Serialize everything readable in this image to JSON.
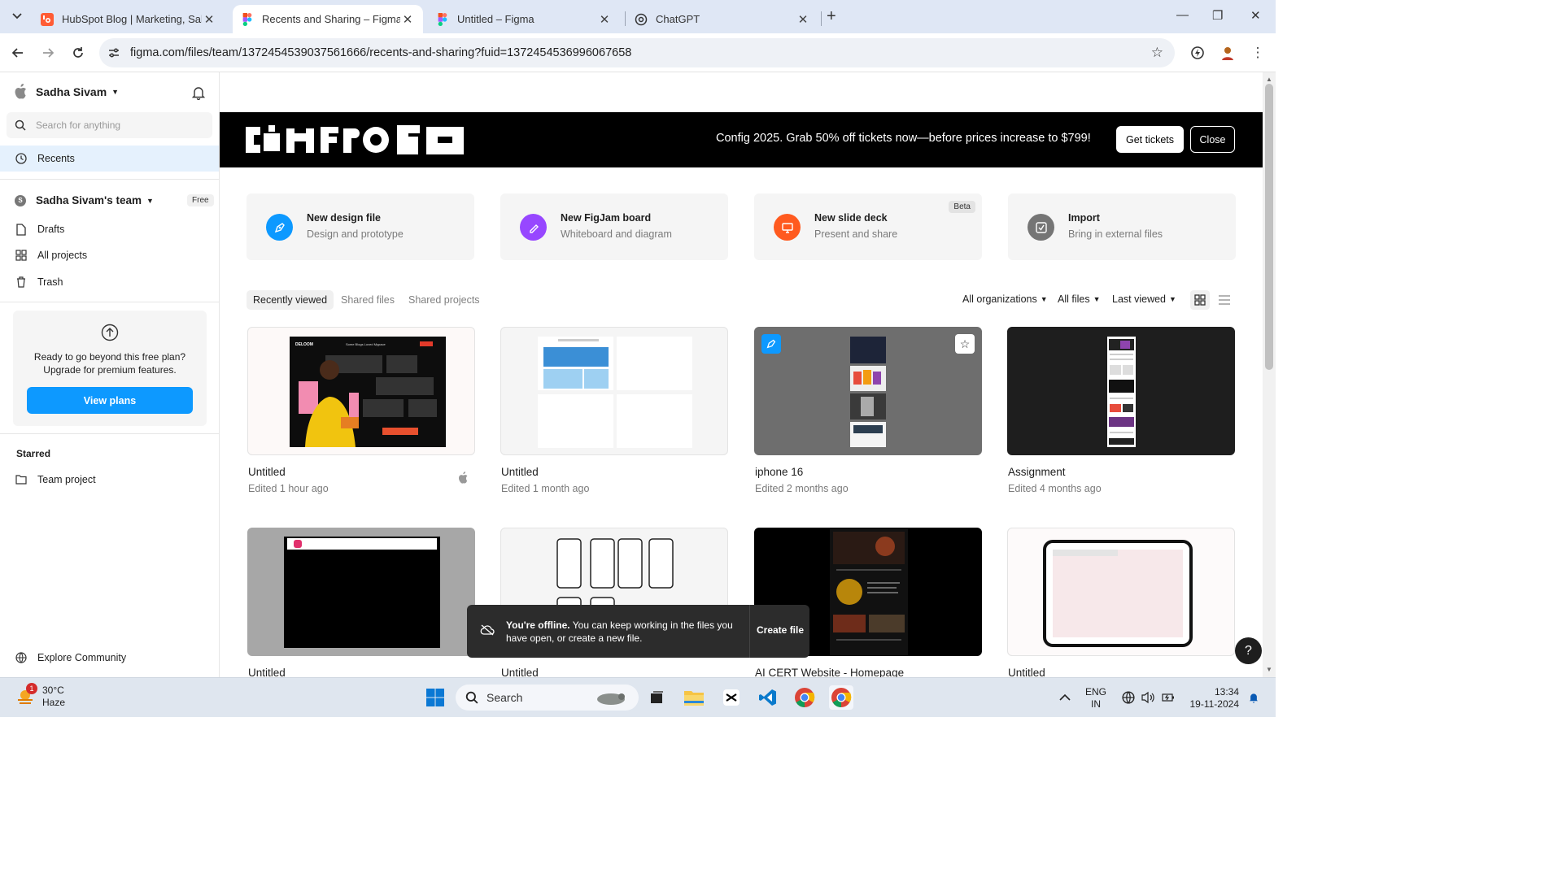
{
  "browser": {
    "tabs": [
      {
        "title": "HubSpot Blog | Marketing, Sales",
        "active": false,
        "favicon": "hubspot-icon"
      },
      {
        "title": "Recents and Sharing – Figma",
        "active": true,
        "favicon": "figma-icon"
      },
      {
        "title": "Untitled – Figma",
        "active": false,
        "favicon": "figma-icon"
      },
      {
        "title": "ChatGPT",
        "active": false,
        "favicon": "chatgpt-icon"
      }
    ],
    "url": "figma.com/files/team/1372454539037561666/recents-and-sharing?fuid=1372454536996067658"
  },
  "sidebar": {
    "user_name": "Sadha Sivam",
    "search_placeholder": "Search for anything",
    "recents_label": "Recents",
    "team_initial": "S",
    "team_name": "Sadha Sivam's team",
    "team_plan": "Free",
    "items": [
      {
        "label": "Drafts",
        "icon": "file-icon"
      },
      {
        "label": "All projects",
        "icon": "grid-icon"
      },
      {
        "label": "Trash",
        "icon": "trash-icon"
      }
    ],
    "upgrade_text_1": "Ready to go beyond this free plan?",
    "upgrade_text_2": "Upgrade for premium features.",
    "view_plans_label": "View plans",
    "starred_heading": "Starred",
    "starred_items": [
      {
        "label": "Team project",
        "icon": "folder-icon"
      }
    ],
    "explore_label": "Explore Community"
  },
  "banner": {
    "logo_text": "CONFIG",
    "message": "Config 2025. Grab 50% off tickets now—before prices increase to $799!",
    "tickets_label": "Get tickets",
    "close_label": "Close"
  },
  "quick_actions": [
    {
      "title": "New design file",
      "subtitle": "Design and prototype",
      "color": "#0d99ff",
      "icon": "pen-icon"
    },
    {
      "title": "New FigJam board",
      "subtitle": "Whiteboard and diagram",
      "color": "#9747ff",
      "icon": "marker-icon"
    },
    {
      "title": "New slide deck",
      "subtitle": "Present and share",
      "color": "#ff5a1f",
      "icon": "presentation-icon",
      "badge": "Beta"
    },
    {
      "title": "Import",
      "subtitle": "Bring in external files",
      "color": "#757575",
      "icon": "import-icon"
    }
  ],
  "filters": {
    "tabs": [
      "Recently viewed",
      "Shared files",
      "Shared projects"
    ],
    "organizations": "All organizations",
    "files": "All files",
    "sort": "Last viewed"
  },
  "files": [
    {
      "name": "Untitled",
      "edited": "Edited 1 hour ago"
    },
    {
      "name": "Untitled",
      "edited": "Edited 1 month ago"
    },
    {
      "name": "iphone 16",
      "edited": "Edited 2 months ago"
    },
    {
      "name": "Assignment",
      "edited": "Edited 4 months ago"
    },
    {
      "name": "Untitled",
      "edited": ""
    },
    {
      "name": "Untitled",
      "edited": ""
    },
    {
      "name": "AI CERT Website - Homepage",
      "edited": ""
    },
    {
      "name": "Untitled",
      "edited": ""
    }
  ],
  "thumb_text": {
    "brand": "DELOOM",
    "headline": "Some Blogs Loved Mypace"
  },
  "toast": {
    "title": "You're offline.",
    "message": "You can keep working in the files you have open, or create a new file.",
    "action": "Create file"
  },
  "help_label": "?",
  "taskbar": {
    "temperature": "30°C",
    "condition": "Haze",
    "notification_count": "1",
    "search_label": "Search",
    "language": "ENG",
    "region": "IN",
    "time": "13:34",
    "date": "19-11-2024"
  }
}
